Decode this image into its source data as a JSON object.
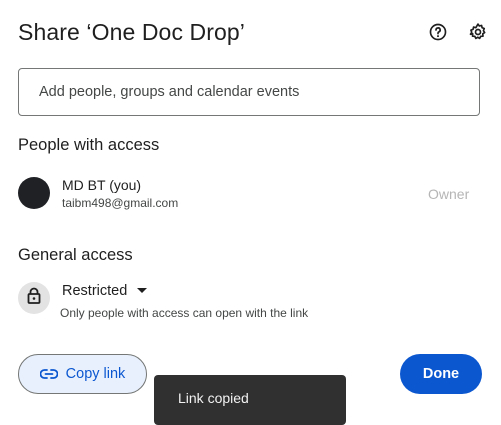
{
  "dialog": {
    "title": "Share ‘One Doc Drop’",
    "help_icon": "help-circle-icon",
    "settings_icon": "gear-icon"
  },
  "add_people": {
    "placeholder": "Add people, groups and calendar events",
    "value": ""
  },
  "people_with_access": {
    "heading": "People with access",
    "people": [
      {
        "name": "MD BT (you)",
        "email": "taibm498@gmail.com",
        "role": "Owner"
      }
    ]
  },
  "general_access": {
    "heading": "General access",
    "lock_icon": "lock-icon",
    "selected": "Restricted",
    "description": "Only people with access can open with the link"
  },
  "actions": {
    "copy_link_label": "Copy link",
    "copy_link_icon": "link-icon",
    "done_label": "Done"
  },
  "toast": {
    "message": "Link copied"
  },
  "colors": {
    "primary": "#0b57d0",
    "copy_bg": "#e8f0fe",
    "toast_bg": "#303030",
    "avatar": "#1f2125"
  }
}
